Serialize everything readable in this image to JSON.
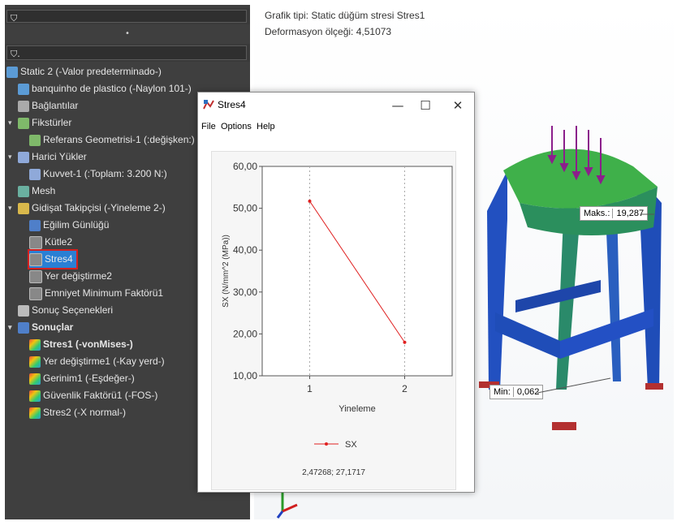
{
  "tree": {
    "filter_icon_1": "filter-icon",
    "collapse_mark": "•",
    "filter_icon_2": "filter-icon",
    "nodes": [
      {
        "label": "Static 2 (-Valor predeterminado-)",
        "icon": "study-icon"
      },
      {
        "label": "banquinho de plastico (-Naylon 101-)",
        "icon": "part-icon"
      },
      {
        "label": "Bağlantılar",
        "icon": "connections-icon"
      },
      {
        "label": "Fikstürler",
        "icon": "fixtures-icon"
      },
      {
        "label": "Referans Geometrisi-1 (:değişken:)",
        "icon": "fixture-item-icon"
      },
      {
        "label": "Harici Yükler",
        "icon": "loads-icon"
      },
      {
        "label": "Kuvvet-1 (:Toplam: 3.200 N:)",
        "icon": "force-icon"
      },
      {
        "label": "Mesh",
        "icon": "mesh-icon"
      },
      {
        "label": "Gidişat Takipçisi (-Yineleme 2-)",
        "icon": "trend-tracker-icon"
      },
      {
        "label": "Eğilim Günlüğü",
        "icon": "journal-icon"
      },
      {
        "label": "Kütle2",
        "icon": "graph-icon"
      },
      {
        "label": "Stres4",
        "icon": "graph-icon"
      },
      {
        "label": "Yer değiştirme2",
        "icon": "graph-icon"
      },
      {
        "label": "Emniyet Minimum Faktörü1",
        "icon": "graph-icon"
      },
      {
        "label": "Sonuç Seçenekleri",
        "icon": "result-options-icon"
      },
      {
        "label": "Sonuçlar",
        "icon": "results-folder-icon"
      },
      {
        "label": "Stres1 (-vonMises-)",
        "icon": "plot-icon"
      },
      {
        "label": "Yer değiştirme1 (-Kay yerd-)",
        "icon": "plot-icon"
      },
      {
        "label": "Gerinim1 (-Eşdeğer-)",
        "icon": "plot-icon"
      },
      {
        "label": "Güvenlik Faktörü1 (-FOS-)",
        "icon": "plot-icon"
      },
      {
        "label": "Stres2 (-X normal-)",
        "icon": "plot-icon"
      }
    ]
  },
  "info": {
    "line1": "Grafik tipi: Static düğüm stresi Stres1",
    "line2": "Deformasyon ölçeği: 4,51073"
  },
  "annotations": {
    "max_label": "Maks.:",
    "max_value": "19,287",
    "min_label": "Min:",
    "min_value": "0,062"
  },
  "window": {
    "title": "Stres4",
    "minimize": "—",
    "maximize": "☐",
    "close": "✕",
    "menu": [
      "File",
      "Options",
      "Help"
    ],
    "status": "2,47268; 27,1717"
  },
  "colors": {
    "series": "#e02020",
    "model_blue": "#1f4db8",
    "model_green": "#3fb04a",
    "arrow": "#8b1f8b"
  },
  "chart_data": {
    "type": "line",
    "x": [
      1,
      2
    ],
    "series": [
      {
        "name": "SX",
        "values": [
          51.7,
          18.0
        ]
      }
    ],
    "xlabel": "Yineleme",
    "ylabel": "SX (N/mm^2 (MPa))",
    "xlim": [
      0.5,
      2.5
    ],
    "ylim": [
      10,
      60
    ],
    "xticks": [
      "1",
      "2"
    ],
    "yticks": [
      "10,00",
      "20,00",
      "30,00",
      "40,00",
      "50,00",
      "60,00"
    ],
    "grid": "vertical dotted",
    "legend": "bottom"
  }
}
